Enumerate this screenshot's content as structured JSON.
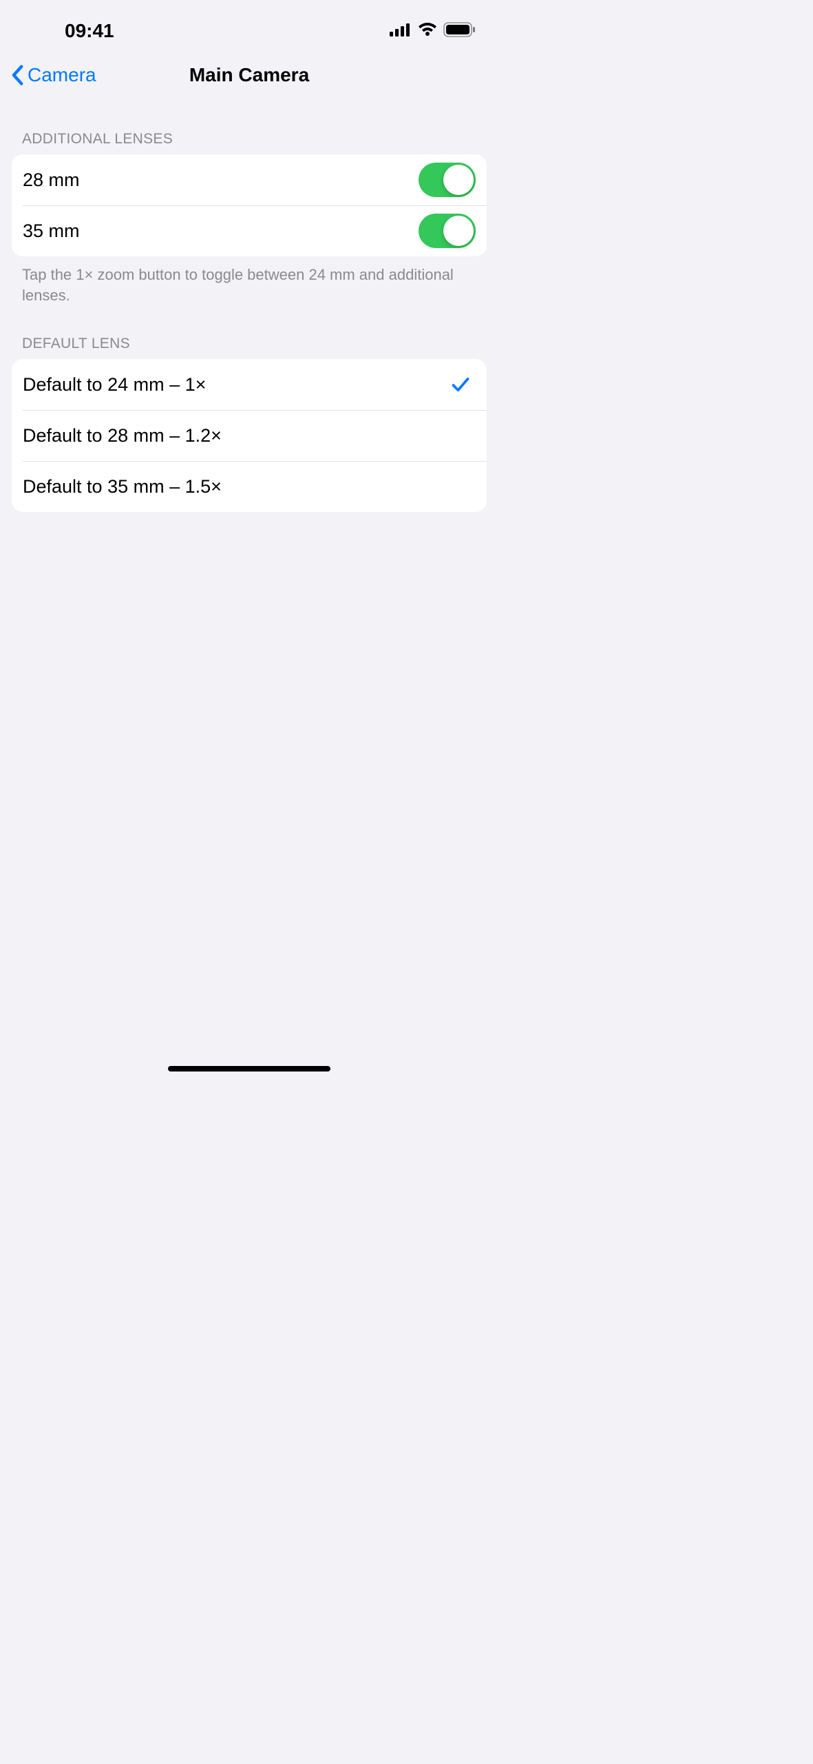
{
  "status": {
    "time": "09:41"
  },
  "nav": {
    "back_label": "Camera",
    "title": "Main Camera"
  },
  "sections": {
    "additional_lenses": {
      "header": "ADDITIONAL LENSES",
      "rows": [
        {
          "label": "28 mm",
          "on": true
        },
        {
          "label": "35 mm",
          "on": true
        }
      ],
      "footer": "Tap the 1× zoom button to toggle between 24 mm and additional lenses."
    },
    "default_lens": {
      "header": "DEFAULT LENS",
      "rows": [
        {
          "label": "Default to 24 mm – 1×",
          "selected": true
        },
        {
          "label": "Default to 28 mm – 1.2×",
          "selected": false
        },
        {
          "label": "Default to 35 mm – 1.5×",
          "selected": false
        }
      ]
    }
  }
}
